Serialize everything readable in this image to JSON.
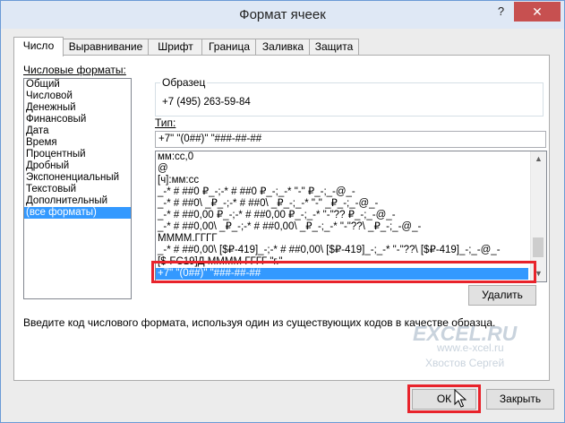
{
  "window": {
    "title": "Формат ячеек",
    "help_glyph": "?",
    "close_glyph": "✕"
  },
  "tabs": [
    {
      "label": "Число"
    },
    {
      "label": "Выравнивание"
    },
    {
      "label": "Шрифт"
    },
    {
      "label": "Граница"
    },
    {
      "label": "Заливка"
    },
    {
      "label": "Защита"
    }
  ],
  "categories_label": "Числовые форматы:",
  "categories": [
    "Общий",
    "Числовой",
    "Денежный",
    "Финансовый",
    "Дата",
    "Время",
    "Процентный",
    "Дробный",
    "Экспоненциальный",
    "Текстовый",
    "Дополнительный",
    "(все форматы)"
  ],
  "selected_category": "(все форматы)",
  "sample": {
    "label": "Образец",
    "value": "+7 (495) 263-59-84"
  },
  "type": {
    "label": "Тип:",
    "value": "+7\" \"(0##)\" \"###-##-##"
  },
  "formats": [
    "мм:сс,0",
    "@",
    "[ч]:мм:сс",
    "_-* # ##0 ₽_-;-* # ##0 ₽_-;_-* \"-\" ₽_-;_-@_-",
    "_-* # ##0\\ _₽_-;-* # ##0\\ _₽_-;_-* \"-\" _₽_-;_-@_-",
    "_-* # ##0,00 ₽_-;-* # ##0,00 ₽_-;_-* \"-\"?? ₽_-;_-@_-",
    "_-* # ##0,00\\ _₽_-;-* # ##0,00\\ _₽_-;_-* \"-\"??\\ _₽_-;_-@_-",
    "ММММ.ГГГГ",
    "_-* # ##0,00\\ [$₽-419]_-;-* # ##0,00\\ [$₽-419]_-;_-* \"-\"??\\ [$₽-419]_-;_-@_-",
    "[$-FC19]Д ММММ ГГГГ \"г.\"",
    "+7\" \"(0##)\" \"###-##-##"
  ],
  "selected_format": "+7\" \"(0##)\" \"###-##-##",
  "buttons": {
    "delete": "Удалить",
    "ok": "ОК",
    "close": "Закрыть"
  },
  "hint": "Введите код числового формата, используя один из существующих кодов в качестве образца.",
  "watermark": {
    "logo": "EXCEL.RU",
    "site": "www.e-xcel.ru",
    "author": "Хвостов Сергей"
  },
  "colors": {
    "selection": "#3399ff",
    "highlight": "#e8232b",
    "close_button": "#c75050"
  }
}
